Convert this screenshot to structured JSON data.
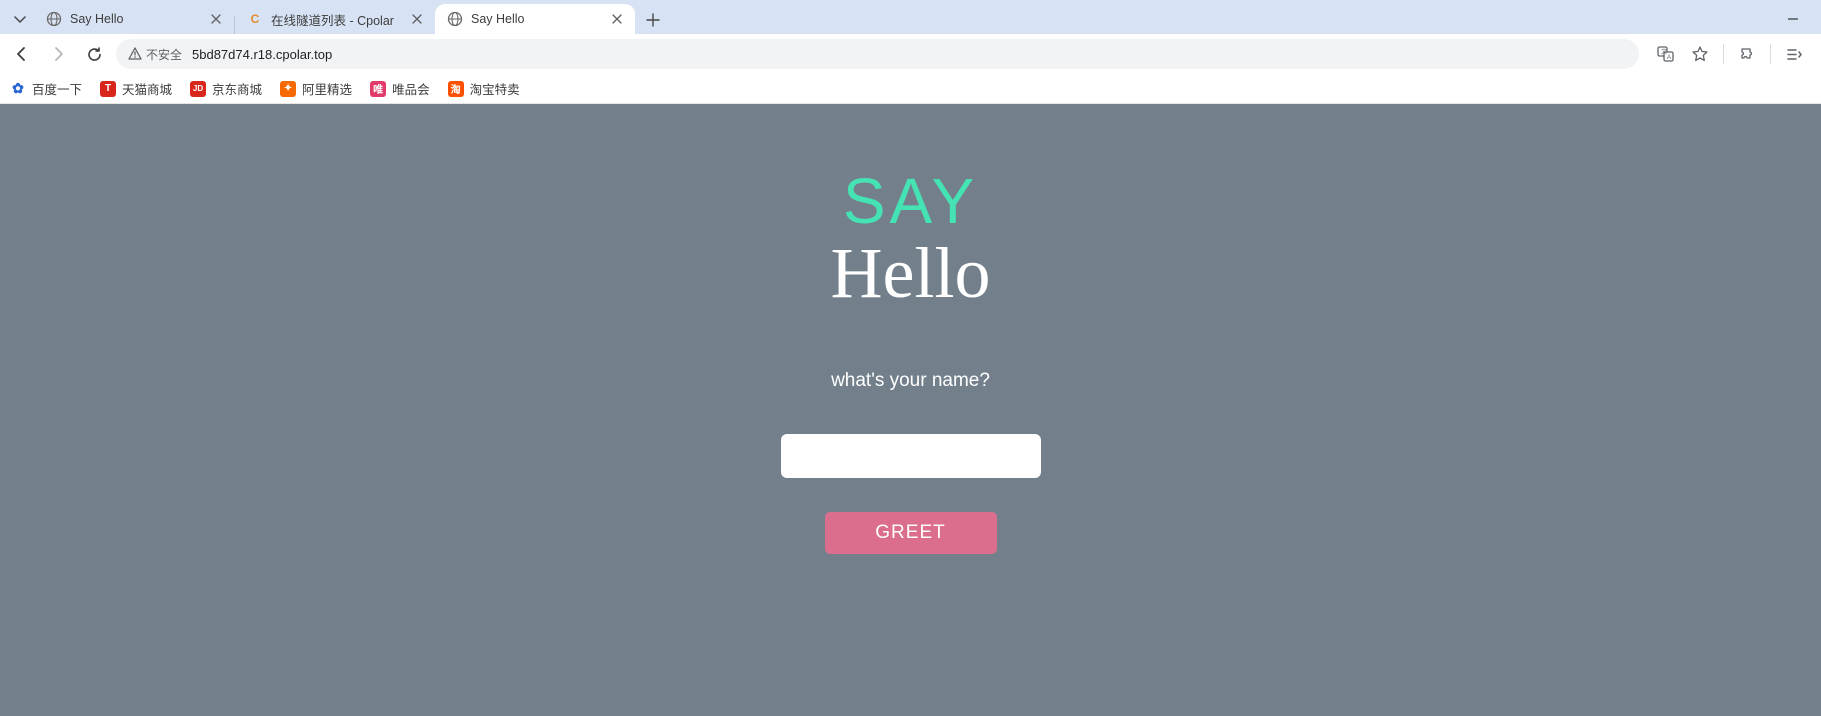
{
  "tabs": [
    {
      "title": "Say Hello",
      "favicon": "globe"
    },
    {
      "title": "在线隧道列表 - Cpolar",
      "favicon": "C",
      "favcolor": "#e38b2d"
    },
    {
      "title": "Say Hello",
      "favicon": "globe"
    }
  ],
  "address": {
    "security_label": "不安全",
    "url": "5bd87d74.r18.cpolar.top"
  },
  "bookmarks": [
    {
      "label": "百度一下",
      "color": "#2a66d1",
      "glyph": "✿"
    },
    {
      "label": "天猫商城",
      "color": "#d8261c",
      "glyph": "T"
    },
    {
      "label": "京东商城",
      "color": "#d8261c",
      "glyph": "JD"
    },
    {
      "label": "阿里精选",
      "color": "#f56900",
      "glyph": "✦"
    },
    {
      "label": "唯品会",
      "color": "#e23b6b",
      "glyph": "唯"
    },
    {
      "label": "淘宝特卖",
      "color": "#ff5000",
      "glyph": "淘"
    }
  ],
  "page": {
    "heading_top": "SAY",
    "heading_bottom": "Hello",
    "prompt": "what's your name?",
    "button": "GREET"
  }
}
